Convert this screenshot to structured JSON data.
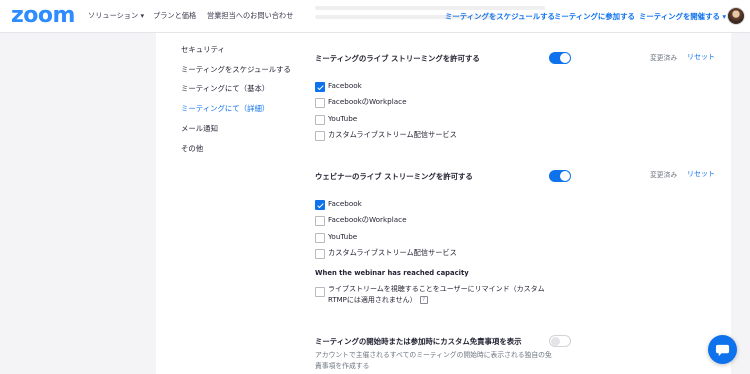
{
  "header": {
    "logo": "zoom",
    "nav_left": [
      "ソリューション ▾",
      "プランと価格",
      "営業担当へのお問い合わせ"
    ],
    "nav_right": [
      "ミーティングをスケジュールする",
      "ミーティングに参加する",
      "ミーティングを開催する ▾"
    ]
  },
  "sidebar": {
    "items": [
      {
        "label": "セキュリティ",
        "active": false
      },
      {
        "label": "ミーティングをスケジュールする",
        "active": false
      },
      {
        "label": "ミーティングにて（基本）",
        "active": false
      },
      {
        "label": "ミーティングにて（詳細）",
        "active": true
      },
      {
        "label": "メール通知",
        "active": false
      },
      {
        "label": "その他",
        "active": false
      }
    ]
  },
  "sections": {
    "meeting_stream": {
      "title": "ミーティングのライブ ストリーミングを許可する",
      "enabled": true,
      "changed": "変更済み",
      "reset": "リセット",
      "options": [
        {
          "label": "Facebook",
          "checked": true
        },
        {
          "label": "FacebookのWorkplace",
          "checked": false
        },
        {
          "label": "YouTube",
          "checked": false
        },
        {
          "label": "カスタムライブストリーム配信サービス",
          "checked": false
        }
      ]
    },
    "webinar_stream": {
      "title": "ウェビナーのライブ ストリーミングを許可する",
      "enabled": true,
      "changed": "変更済み",
      "reset": "リセット",
      "options": [
        {
          "label": "Facebook",
          "checked": true
        },
        {
          "label": "FacebookのWorkplace",
          "checked": false
        },
        {
          "label": "YouTube",
          "checked": false
        },
        {
          "label": "カスタムライブストリーム配信サービス",
          "checked": false
        }
      ],
      "capacity_heading": "When the webinar has reached capacity",
      "remind_label": "ライブストリームを視聴することをユーザーにリマインド（カスタムRTMPには適用されません）",
      "remind_checked": false
    },
    "disclaimer": {
      "title": "ミーティングの開始時または参加時にカスタム免責事項を表示",
      "enabled": false,
      "description": "アカウントで主催されるすべてのミーティングの開始時に表示される独自の免責事項を作成する"
    }
  },
  "colors": {
    "accent": "#0e72ed",
    "logo": "#2d8cff",
    "background": "#f4f4f6"
  }
}
